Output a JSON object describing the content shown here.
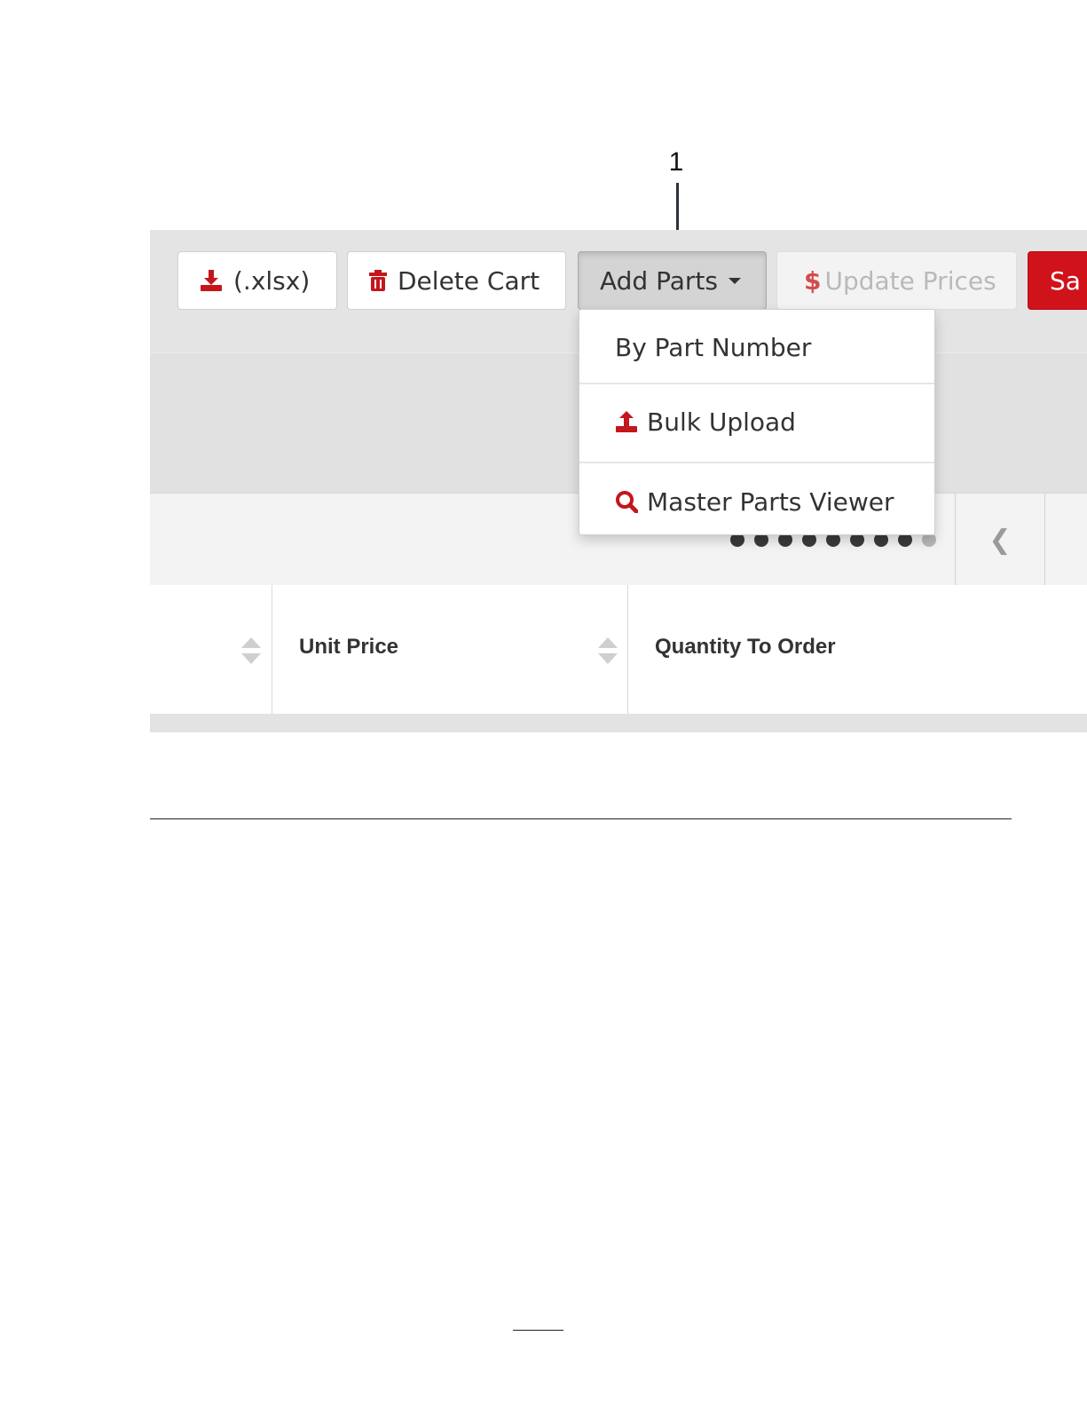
{
  "callout": {
    "label": "1"
  },
  "toolbar": {
    "export_label": "(.xlsx)",
    "delete_label": "Delete Cart",
    "add_parts_label": "Add Parts",
    "update_prices_label": "Update Prices",
    "update_prices_prefix": "$",
    "save_label_visible": "Sa"
  },
  "add_parts_menu": {
    "items": [
      {
        "label": "By Part Number",
        "icon": "none"
      },
      {
        "label": "Bulk Upload",
        "icon": "upload-icon"
      },
      {
        "label": "Master Parts Viewer",
        "icon": "search-icon"
      }
    ]
  },
  "pager": {
    "total_dots": 9,
    "active_dots": 8
  },
  "table": {
    "columns": [
      {
        "label": ""
      },
      {
        "label": "Unit Price"
      },
      {
        "label": "Quantity To Order"
      }
    ]
  },
  "colors": {
    "accent": "#d0121b",
    "text": "#333333"
  }
}
